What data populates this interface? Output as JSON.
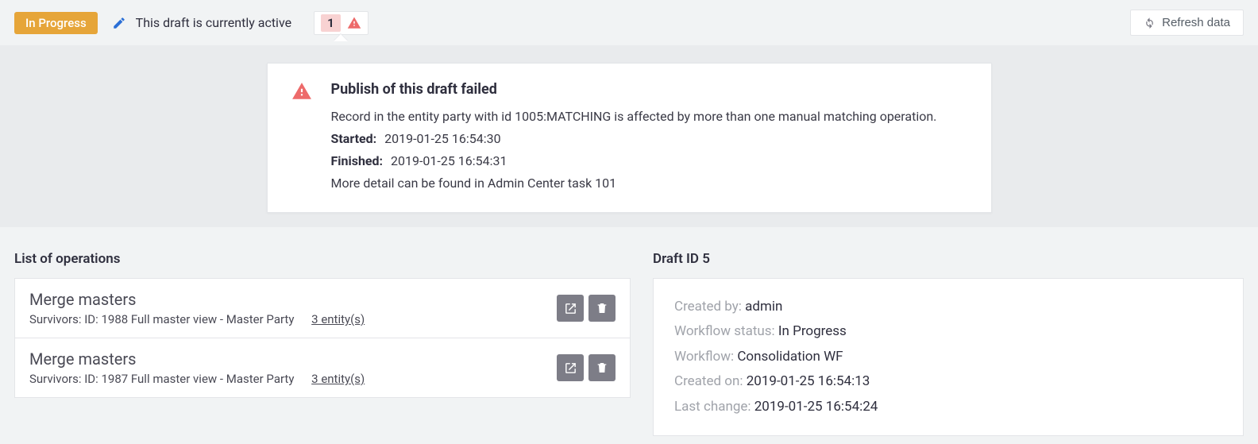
{
  "topbar": {
    "status": "In Progress",
    "draft_active_text": "This draft is currently active",
    "alert_count": "1",
    "refresh_label": "Refresh data"
  },
  "alert": {
    "title": "Publish of this draft failed",
    "message": "Record in the entity party with id 1005:MATCHING is affected by more than one manual matching operation.",
    "started_label": "Started:",
    "started": "2019-01-25 16:54:30",
    "finished_label": "Finished:",
    "finished": "2019-01-25 16:54:31",
    "more_detail": "More detail can be found in Admin Center task 101"
  },
  "operations": {
    "heading": "List of operations",
    "items": [
      {
        "title": "Merge masters",
        "survivors": "Survivors: ID: 1988 Full master view - Master Party",
        "entity_link": "3 entity(s)"
      },
      {
        "title": "Merge masters",
        "survivors": "Survivors: ID: 1987 Full master view - Master Party",
        "entity_link": "3 entity(s)"
      }
    ]
  },
  "detail": {
    "heading": "Draft ID 5",
    "rows": {
      "created_by": {
        "k": "Created by: ",
        "v": "admin"
      },
      "workflow_status": {
        "k": "Workflow status: ",
        "v": "In Progress"
      },
      "workflow": {
        "k": "Workflow: ",
        "v": "Consolidation WF"
      },
      "created_on": {
        "k": "Created on: ",
        "v": "2019-01-25 16:54:13"
      },
      "last_change": {
        "k": "Last change: ",
        "v": "2019-01-25 16:54:24"
      }
    }
  }
}
